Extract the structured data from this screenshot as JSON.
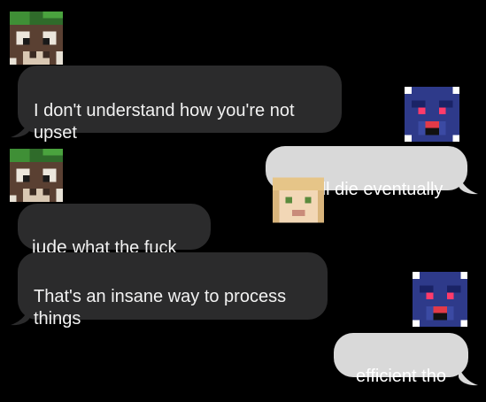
{
  "conversation": {
    "messages": [
      {
        "sender_side": "incoming",
        "text": "I don't understand how you're not\nupset"
      },
      {
        "sender_side": "outgoing",
        "text": "she'll die eventually"
      },
      {
        "sender_side": "incoming",
        "name": "jude",
        "text": "what the fuck"
      },
      {
        "sender_side": "incoming",
        "text": "That's an insane way to process\nthings"
      },
      {
        "sender_side": "outgoing",
        "text": "efficient tho"
      }
    ]
  },
  "avatars": {
    "green_cow": "green-cow-head-icon",
    "blue_bunny": "blue-animatronic-bunny-head-icon",
    "blonde_girl": "blonde-girl-head-icon"
  },
  "colors": {
    "background": "#000000",
    "incoming_bubble": "#2b2b2c",
    "outgoing_bubble": "#d9d9d9",
    "incoming_text": "#f2f2f2",
    "outgoing_text": "#ffffff"
  }
}
